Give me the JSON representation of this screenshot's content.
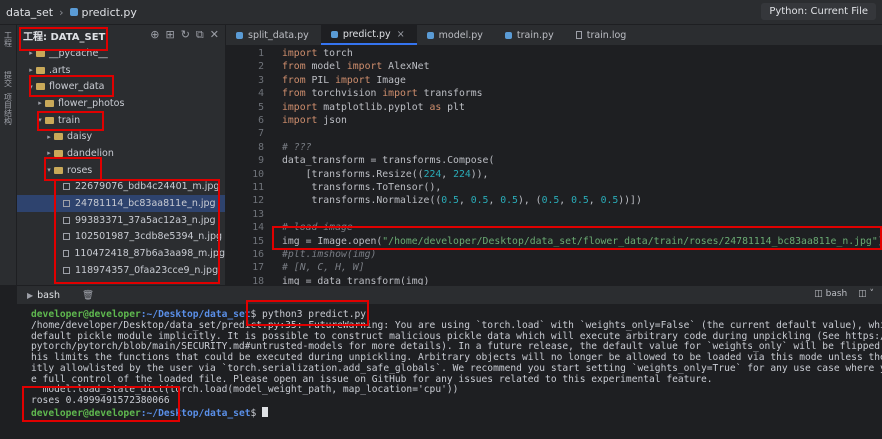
{
  "topbar": {
    "project": "data_set",
    "file": "predict.py",
    "run_config": "Python: Current File"
  },
  "leftstrip": {
    "label_project": "工程",
    "label_structure": "提交",
    "label_tools": "项目结构"
  },
  "project_panel": {
    "title": "工程: DATA_SET",
    "items": [
      {
        "label": "__pycache__",
        "indent": 1,
        "arrow": "▸",
        "type": "folder"
      },
      {
        "label": ".arts",
        "indent": 1,
        "arrow": "▸",
        "type": "folder"
      },
      {
        "label": "flower_data",
        "indent": 1,
        "arrow": "▾",
        "type": "folder"
      },
      {
        "label": "flower_photos",
        "indent": 2,
        "arrow": "▸",
        "type": "folder"
      },
      {
        "label": "train",
        "indent": 2,
        "arrow": "▾",
        "type": "folder"
      },
      {
        "label": "daisy",
        "indent": 3,
        "arrow": "▸",
        "type": "folder"
      },
      {
        "label": "dandelion",
        "indent": 3,
        "arrow": "▸",
        "type": "folder"
      },
      {
        "label": "roses",
        "indent": 3,
        "arrow": "▾",
        "type": "folder"
      },
      {
        "label": "22679076_bdb4c24401_m.jpg",
        "indent": 4,
        "arrow": "",
        "type": "image"
      },
      {
        "label": "24781114_bc83aa811e_n.jpg",
        "indent": 4,
        "arrow": "",
        "type": "image",
        "selected": true
      },
      {
        "label": "99383371_37a5ac12a3_n.jpg",
        "indent": 4,
        "arrow": "",
        "type": "image"
      },
      {
        "label": "102501987_3cdb8e5394_n.jpg",
        "indent": 4,
        "arrow": "",
        "type": "image"
      },
      {
        "label": "110472418_87b6a3aa98_m.jpg",
        "indent": 4,
        "arrow": "",
        "type": "image"
      },
      {
        "label": "118974357_0faa23cce9_n.jpg",
        "indent": 4,
        "arrow": "",
        "type": "image"
      }
    ]
  },
  "tabs": [
    {
      "label": "split_data.py",
      "kind": "py"
    },
    {
      "label": "predict.py",
      "kind": "py",
      "active": true,
      "close": "×"
    },
    {
      "label": "model.py",
      "kind": "py"
    },
    {
      "label": "train.py",
      "kind": "py"
    },
    {
      "label": "train.log",
      "kind": "log"
    }
  ],
  "code": [
    {
      "n": "1",
      "html": "<span class='kw'>import</span> torch"
    },
    {
      "n": "2",
      "html": "<span class='kw'>from</span> model <span class='kw'>import</span> AlexNet"
    },
    {
      "n": "3",
      "html": "<span class='kw'>from</span> PIL <span class='kw'>import</span> Image"
    },
    {
      "n": "4",
      "html": "<span class='kw'>from</span> torchvision <span class='kw'>import</span> transforms"
    },
    {
      "n": "5",
      "html": "<span class='kw'>import</span> matplotlib.pyplot <span class='kw'>as</span> plt"
    },
    {
      "n": "6",
      "html": "<span class='kw'>import</span> json"
    },
    {
      "n": "7",
      "html": ""
    },
    {
      "n": "8",
      "html": "<span class='com'># ???</span>"
    },
    {
      "n": "9",
      "html": "data_transform = transforms.Compose("
    },
    {
      "n": "10",
      "html": "    [transforms.Resize((<span class='numv'>224</span>, <span class='numv'>224</span>)),"
    },
    {
      "n": "11",
      "html": "     transforms.ToTensor(),"
    },
    {
      "n": "12",
      "html": "     transforms.Normalize((<span class='numv'>0.5</span>, <span class='numv'>0.5</span>, <span class='numv'>0.5</span>), (<span class='numv'>0.5</span>, <span class='numv'>0.5</span>, <span class='numv'>0.5</span>))])"
    },
    {
      "n": "13",
      "html": ""
    },
    {
      "n": "14",
      "html": "<span class='com'># load image</span>"
    },
    {
      "n": "15",
      "html": "img = Image.open(<span class='str'>\"/home/developer/Desktop/data_set/flower_data/train/roses/24781114_bc83aa811e_n.jpg\"</span>)"
    },
    {
      "n": "16",
      "html": "<span class='com'>#plt.imshow(img)</span>"
    },
    {
      "n": "17",
      "html": "<span class='com'># [N, C, H, W]</span>"
    },
    {
      "n": "18",
      "html": "img = data_transform(img)"
    }
  ],
  "terminal": {
    "tab_label": "bash",
    "right_label": "bash",
    "prompt_user": "developer@developer",
    "prompt_path": ":~/Desktop/data_set",
    "prompt_symbol": "$",
    "command": " python3 predict.py",
    "output": [
      "/home/developer/Desktop/data_set/predict.py:35: FutureWarning: You are using `torch.load` with `weights_only=False` (the current default value), which u",
      "default pickle module implicitly. It is possible to construct malicious pickle data which will execute arbitrary code during unpickling (See https://gi",
      "pytorch/pytorch/blob/main/SECURITY.md#untrusted-models for more details). In a future release, the default value for `weights_only` will be flipped to",
      "his limits the functions that could be executed during unpickling. Arbitrary objects will no longer be allowed to be loaded via this mode unless they a",
      "itly allowlisted by the user via `torch.serialization.add_safe_globals`. We recommend you start setting `weights_only=True` for any use case where you",
      "e full control of the loaded file. Please open an issue on GitHub for any issues related to this experimental feature.",
      "  model.load_state_dict(torch.load(model_weight_path, map_location='cpu'))",
      "roses 0.4999491572380066"
    ]
  }
}
